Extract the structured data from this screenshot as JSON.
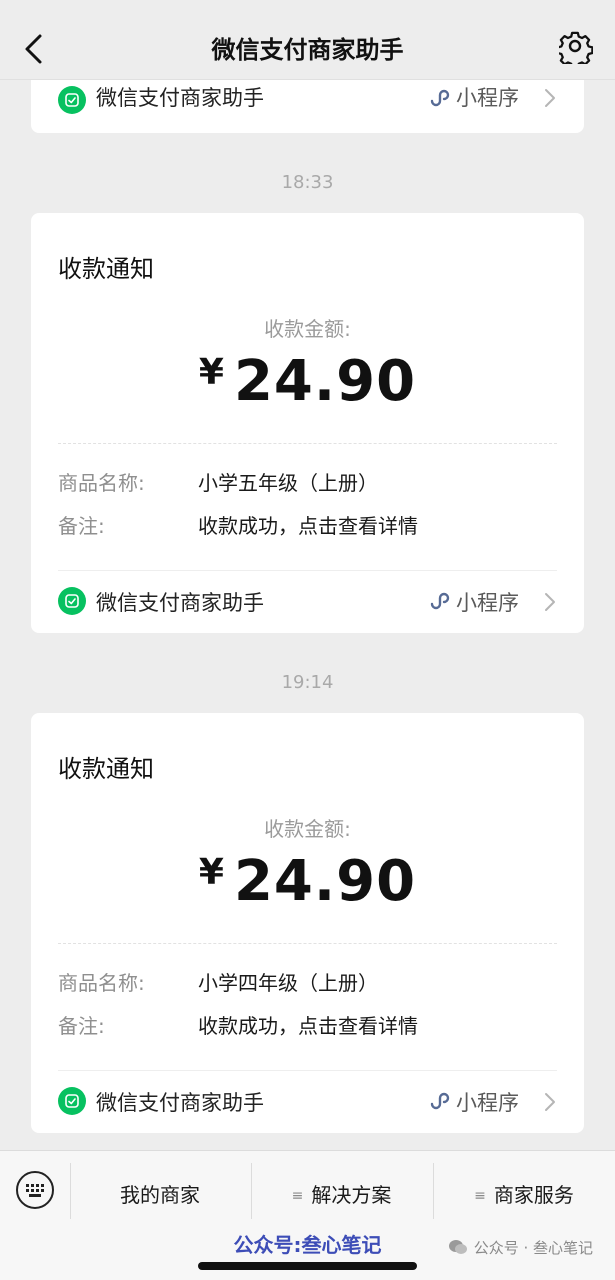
{
  "header": {
    "title": "微信支付商家助手",
    "back_icon": "chevron-left-icon",
    "settings_icon": "gear-icon"
  },
  "top_card": {
    "source": "微信支付商家助手",
    "mini_program_label": "小程序"
  },
  "messages": [
    {
      "time": "18:33",
      "title": "收款通知",
      "amount_label": "收款金额:",
      "currency": "¥",
      "amount": "24.90",
      "product_label": "商品名称:",
      "product_value": "小学五年级（上册）",
      "note_label": "备注:",
      "note_value": "收款成功，点击查看详情",
      "source": "微信支付商家助手",
      "mini_program_label": "小程序"
    },
    {
      "time": "19:14",
      "title": "收款通知",
      "amount_label": "收款金额:",
      "currency": "¥",
      "amount": "24.90",
      "product_label": "商品名称:",
      "product_value": "小学四年级（上册）",
      "note_label": "备注:",
      "note_value": "收款成功，点击查看详情",
      "source": "微信支付商家助手",
      "mini_program_label": "小程序"
    }
  ],
  "menu": {
    "keyboard_icon": "keyboard-icon",
    "items": [
      "我的商家",
      "解决方案",
      "商家服务"
    ]
  },
  "watermark": {
    "left": "公众号:叁心笔记",
    "right": "公众号 · 叁心笔记"
  },
  "colors": {
    "background": "#ededed",
    "card": "#ffffff",
    "wechat_green": "#07c160",
    "mini_program_blue": "#576b95",
    "watermark_blue": "#3d4db7"
  }
}
